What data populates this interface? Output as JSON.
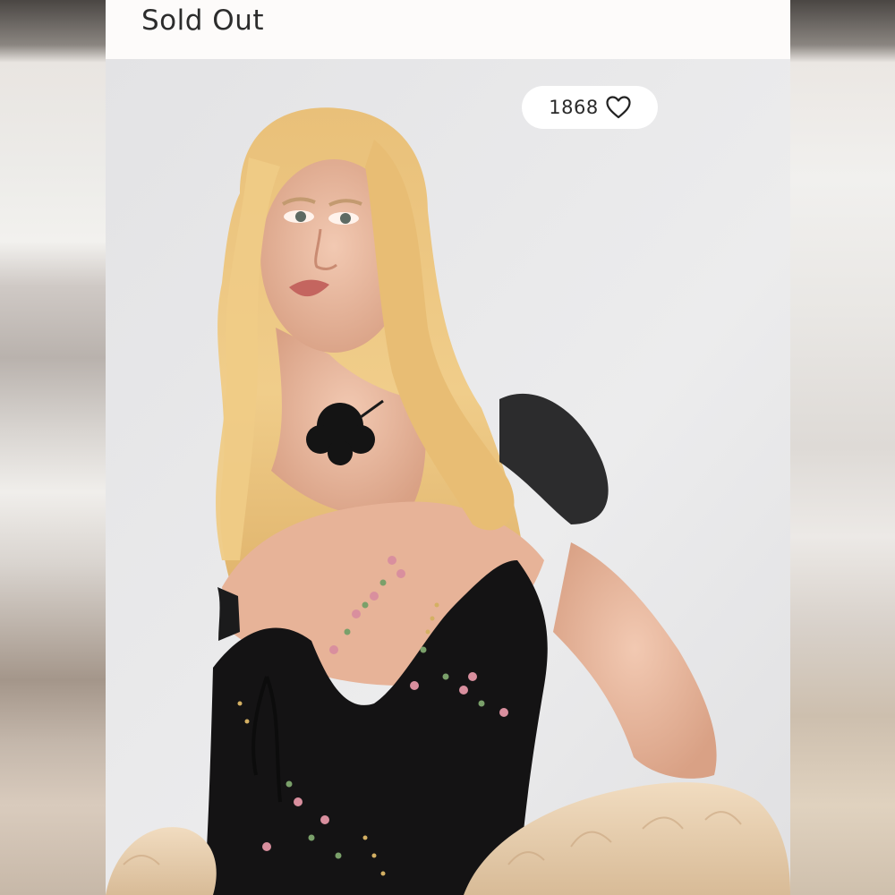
{
  "listing": {
    "status_label": "Sold Out",
    "like_count": "1868",
    "like_icon": "heart-outline-icon"
  },
  "photo": {
    "subject_icon": "product-photo"
  },
  "colors": {
    "status_bar": "#fdfbfa",
    "photo_backdrop": "#e6e6e7",
    "pill": "#ffffff",
    "text": "#2c2c2c"
  }
}
